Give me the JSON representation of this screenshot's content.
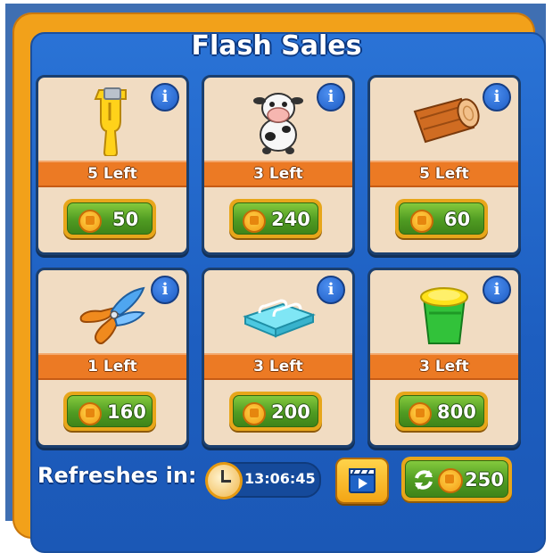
{
  "title": "Flash Sales",
  "items": [
    {
      "icon": "peeler-icon",
      "left_text": "5 Left",
      "price": "50"
    },
    {
      "icon": "cow-icon",
      "left_text": "3 Left",
      "price": "240"
    },
    {
      "icon": "log-icon",
      "left_text": "5 Left",
      "price": "60"
    },
    {
      "icon": "pruning-shears-icon",
      "left_text": "1 Left",
      "price": "160"
    },
    {
      "icon": "soap-dish-icon",
      "left_text": "3 Left",
      "price": "200"
    },
    {
      "icon": "green-bucket-icon",
      "left_text": "3 Left",
      "price": "800"
    }
  ],
  "footer": {
    "refresh_label": "Refreshes in:",
    "timer": "13:06:45",
    "refresh_cost": "250"
  }
}
